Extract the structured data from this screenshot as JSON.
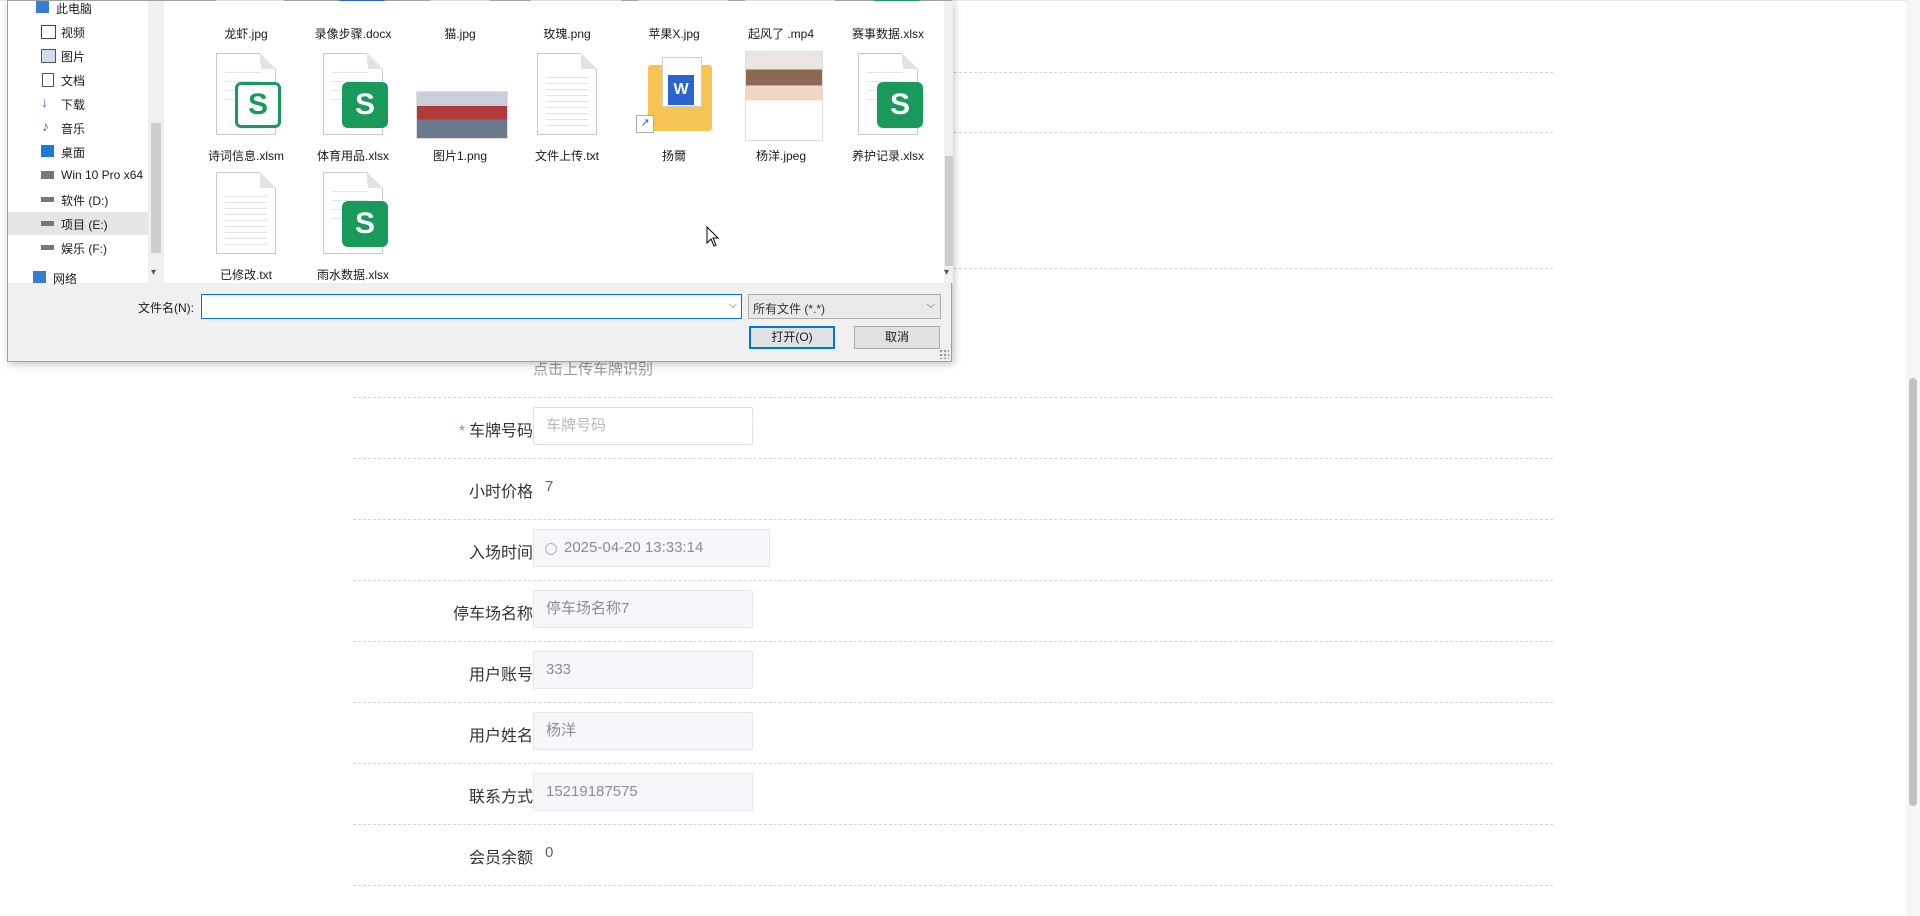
{
  "form": {
    "hint": "点击上传车牌识别",
    "fields": [
      {
        "label": "车牌号码",
        "required": true,
        "placeholder": "车牌号码"
      },
      {
        "label": "小时价格",
        "value": "7"
      },
      {
        "label": "入场时间",
        "value": "2025-04-20 13:33:14"
      },
      {
        "label": "停车场名称",
        "value": "停车场名称7"
      },
      {
        "label": "用户账号",
        "value": "333"
      },
      {
        "label": "用户姓名",
        "value": "杨洋"
      },
      {
        "label": "联系方式",
        "value": "15219187575"
      },
      {
        "label": "会员余额",
        "value": "0"
      }
    ]
  },
  "dialog": {
    "nav": [
      {
        "label": "此电脑",
        "icon": "computer-icon"
      },
      {
        "label": "视频",
        "icon": "video-icon"
      },
      {
        "label": "图片",
        "icon": "picture-icon"
      },
      {
        "label": "文档",
        "icon": "document-icon"
      },
      {
        "label": "下载",
        "icon": "download-icon"
      },
      {
        "label": "音乐",
        "icon": "music-icon"
      },
      {
        "label": "桌面",
        "icon": "desktop-icon"
      },
      {
        "label": "Win 10 Pro x64",
        "icon": "drive-icon"
      },
      {
        "label": "软件 (D:)",
        "icon": "drive-icon"
      },
      {
        "label": "项目 (E:)",
        "icon": "drive-icon",
        "selected": true
      },
      {
        "label": "娱乐 (F:)",
        "icon": "drive-icon"
      },
      {
        "label": "网络",
        "icon": "network-icon"
      }
    ],
    "files_row1": [
      "龙虾.jpg",
      "录像步骤.docx",
      "猫.jpg",
      "玫瑰.png",
      "苹果X.jpg",
      "起风了 .mp4",
      "赛事数据.xlsx"
    ],
    "files_row2": [
      "诗词信息.xlsm",
      "体育用品.xlsx",
      "图片1.png",
      "文件上传.txt",
      "扬爾",
      "杨洋.jpeg",
      "养护记录.xlsx"
    ],
    "files_row3": [
      "已修改.txt",
      "雨水数据.xlsx"
    ],
    "filename_label": "文件名(N):",
    "filename_value": "",
    "filetype": "所有文件 (*.*)",
    "open_button": "打开(O)",
    "cancel_button": "取消"
  }
}
